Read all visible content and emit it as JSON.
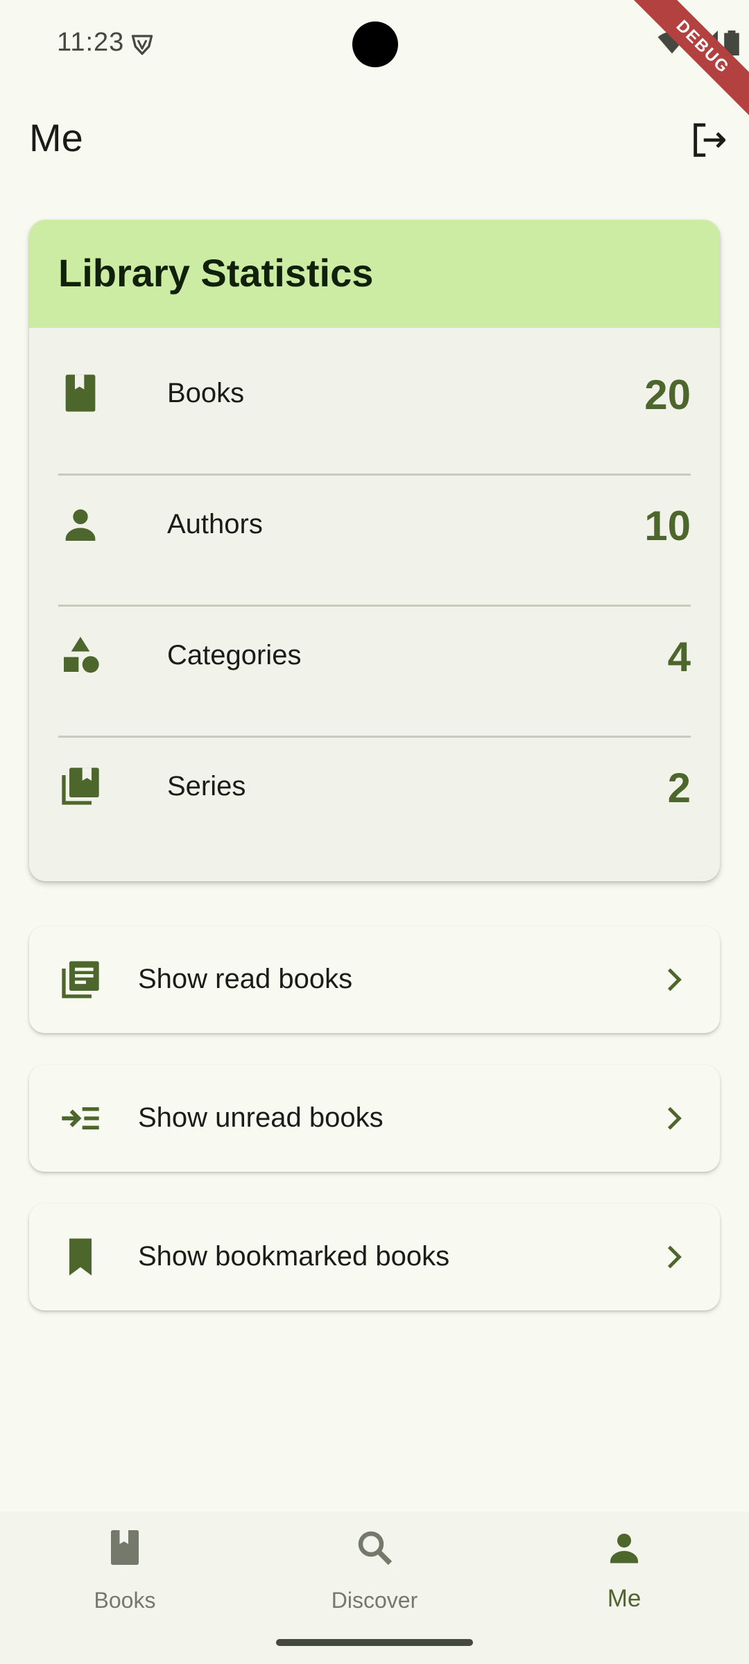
{
  "status_bar": {
    "time": "11:23",
    "debug_label": "DEBUG"
  },
  "app_bar": {
    "title": "Me",
    "logout_icon": "logout-icon"
  },
  "statistics": {
    "title": "Library Statistics",
    "rows": [
      {
        "icon": "book-icon",
        "label": "Books",
        "value": "20"
      },
      {
        "icon": "person-icon",
        "label": "Authors",
        "value": "10"
      },
      {
        "icon": "category-shapes-icon",
        "label": "Categories",
        "value": "4"
      },
      {
        "icon": "library-books-icon",
        "label": "Series",
        "value": "2"
      }
    ]
  },
  "actions": [
    {
      "icon": "read-list-icon",
      "label": "Show read books"
    },
    {
      "icon": "unread-list-icon",
      "label": "Show unread books"
    },
    {
      "icon": "bookmark-icon",
      "label": "Show bookmarked books"
    }
  ],
  "bottom_nav": {
    "items": [
      {
        "icon": "book-icon",
        "label": "Books",
        "active": false
      },
      {
        "icon": "search-icon",
        "label": "Discover",
        "active": false
      },
      {
        "icon": "person-icon",
        "label": "Me",
        "active": true
      }
    ]
  },
  "colors": {
    "primary": "#4c662b",
    "header_bg": "#cbeca2",
    "background": "#f8f9f1",
    "card_bg": "#f1f2ea",
    "debug": "#b3413f"
  }
}
